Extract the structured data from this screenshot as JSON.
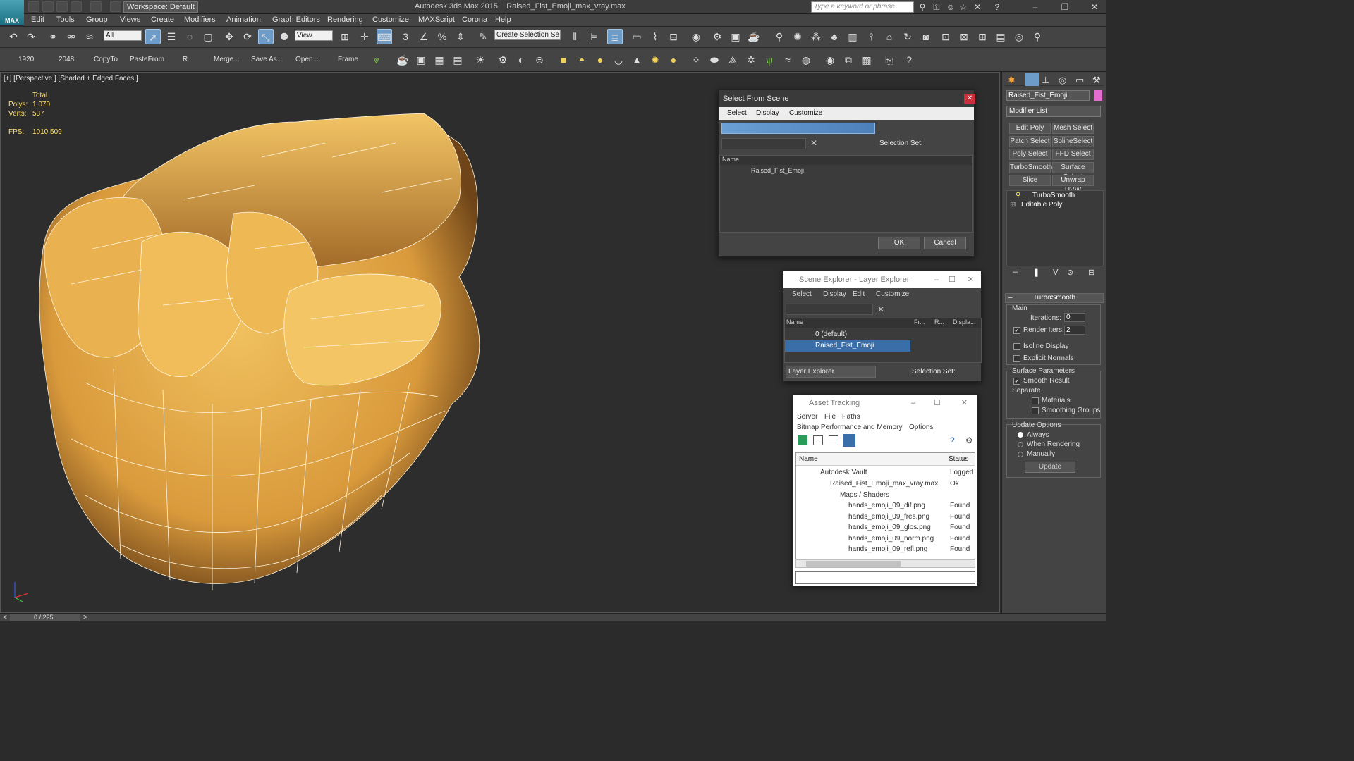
{
  "title": {
    "app": "Autodesk 3ds Max  2015",
    "file": "Raised_Fist_Emoji_max_vray.max",
    "workspace": "Workspace: Default",
    "search_placeholder": "Type a keyword or phrase"
  },
  "menu": [
    "Edit",
    "Tools",
    "Group",
    "Views",
    "Create",
    "Modifiers",
    "Animation",
    "Graph Editors",
    "Rendering",
    "Customize",
    "MAXScript",
    "Corona",
    "Help"
  ],
  "toolbar": {
    "selection_filter": "All",
    "ref_coord": "View",
    "selection_set": "Create Selection Se"
  },
  "toolbar2": {
    "b1": "1920",
    "b2": "2048",
    "b3": "CopyTo",
    "b4": "PasteFrom",
    "b5": "R",
    "b6": "Merge...",
    "b7": "Save As...",
    "b8": "Open...",
    "b9": "Frame"
  },
  "viewport": {
    "label": "[+] [Perspective ] [Shaded + Edged Faces ]",
    "total": "Total",
    "polys_label": "Polys:",
    "polys": "1 070",
    "verts_label": "Verts:",
    "verts": "537",
    "fps_label": "FPS:",
    "fps": "1010.509"
  },
  "select_from_scene": {
    "title": "Select From Scene",
    "menu": [
      "Select",
      "Display",
      "Customize"
    ],
    "selection_set": "Selection Set:",
    "col_name": "Name",
    "item": "Raised_Fist_Emoji",
    "ok": "OK",
    "cancel": "Cancel"
  },
  "scene_explorer": {
    "title": "Scene Explorer - Layer Explorer",
    "menu": [
      "Select",
      "Display",
      "Edit",
      "Customize"
    ],
    "col_name": "Name",
    "col_fr": "Fr...",
    "col_r": "R...",
    "col_disp": "Displa...",
    "rows": [
      "0 (default)",
      "Raised_Fist_Emoji"
    ],
    "footer": "Layer Explorer",
    "selection_set": "Selection Set:"
  },
  "asset_tracking": {
    "title": "Asset Tracking",
    "menu": [
      "Server",
      "File",
      "Paths"
    ],
    "menu2": [
      "Bitmap Performance and Memory",
      "Options"
    ],
    "col_name": "Name",
    "col_status": "Status",
    "rows": [
      {
        "name": "Autodesk Vault",
        "status": "Logged"
      },
      {
        "name": "Raised_Fist_Emoji_max_vray.max",
        "status": "Ok"
      },
      {
        "name": "Maps / Shaders",
        "status": ""
      },
      {
        "name": "hands_emoji_09_dif.png",
        "status": "Found"
      },
      {
        "name": "hands_emoji_09_fres.png",
        "status": "Found"
      },
      {
        "name": "hands_emoji_09_glos.png",
        "status": "Found"
      },
      {
        "name": "hands_emoji_09_norm.png",
        "status": "Found"
      },
      {
        "name": "hands_emoji_09_refl.png",
        "status": "Found"
      }
    ]
  },
  "command_panel": {
    "object_name": "Raised_Fist_Emoji",
    "modifier_list": "Modifier List",
    "buttons": [
      "Edit Poly",
      "Mesh Select",
      "Patch Select",
      "SplineSelect",
      "Poly Select",
      "FFD Select",
      "TurboSmooth",
      "Surface Select",
      "Slice",
      "Unwrap UVW"
    ],
    "stack": [
      "TurboSmooth",
      "Editable Poly"
    ],
    "rollout": "TurboSmooth",
    "main": "Main",
    "iterations_label": "Iterations:",
    "iterations": "0",
    "render_iters_label": "Render Iters:",
    "render_iters": "2",
    "isoline": "Isoline Display",
    "explicit": "Explicit Normals",
    "surface_params": "Surface Parameters",
    "smooth_result": "Smooth Result",
    "separate": "Separate",
    "materials": "Materials",
    "smoothing_groups": "Smoothing Groups",
    "update_options": "Update Options",
    "always": "Always",
    "when_rendering": "When Rendering",
    "manually": "Manually",
    "update": "Update"
  },
  "status": {
    "frames": "0 / 225"
  },
  "colors": {
    "accent": "#6e9cc8",
    "selection": "#3a6ea8",
    "fist": "#e3a84a"
  }
}
